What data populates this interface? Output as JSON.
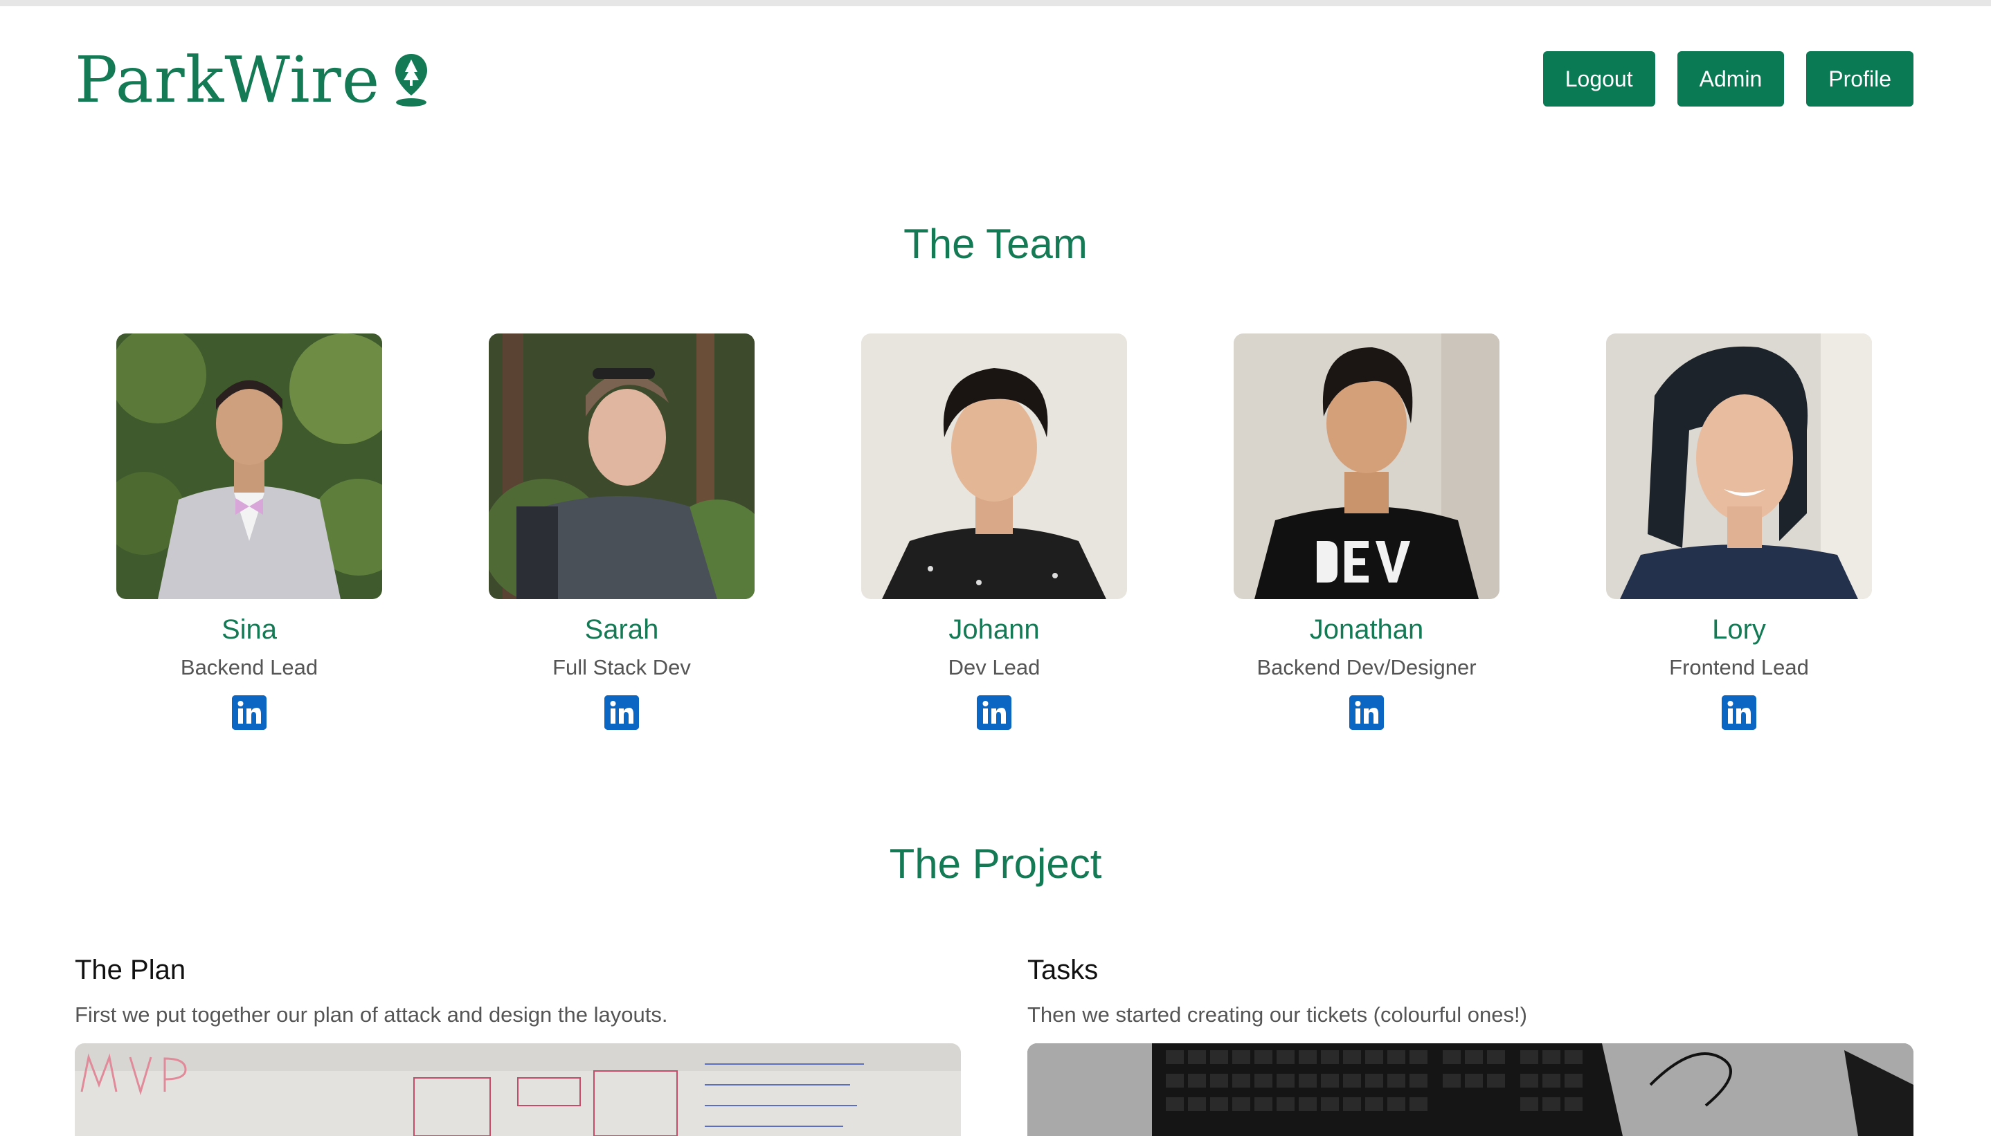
{
  "header": {
    "logo_text": "ParkWire",
    "nav": {
      "logout_label": "Logout",
      "admin_label": "Admin",
      "profile_label": "Profile"
    }
  },
  "team": {
    "title": "The Team",
    "members": [
      {
        "name": "Sina",
        "role": "Backend Lead",
        "icon": "linkedin-icon"
      },
      {
        "name": "Sarah",
        "role": "Full Stack Dev",
        "icon": "linkedin-icon"
      },
      {
        "name": "Johann",
        "role": "Dev Lead",
        "icon": "linkedin-icon"
      },
      {
        "name": "Jonathan",
        "role": "Backend Dev/Designer",
        "icon": "linkedin-icon"
      },
      {
        "name": "Lory",
        "role": "Frontend Lead",
        "icon": "linkedin-icon"
      }
    ]
  },
  "project": {
    "title": "The Project",
    "items": [
      {
        "title": "The Plan",
        "text": "First we put together our plan of attack and design the layouts."
      },
      {
        "title": "Tasks",
        "text": "Then we started creating our tickets (colourful ones!)"
      }
    ]
  },
  "colors": {
    "brand_green": "#0a7a55",
    "linkedin_blue": "#0a66c2"
  }
}
